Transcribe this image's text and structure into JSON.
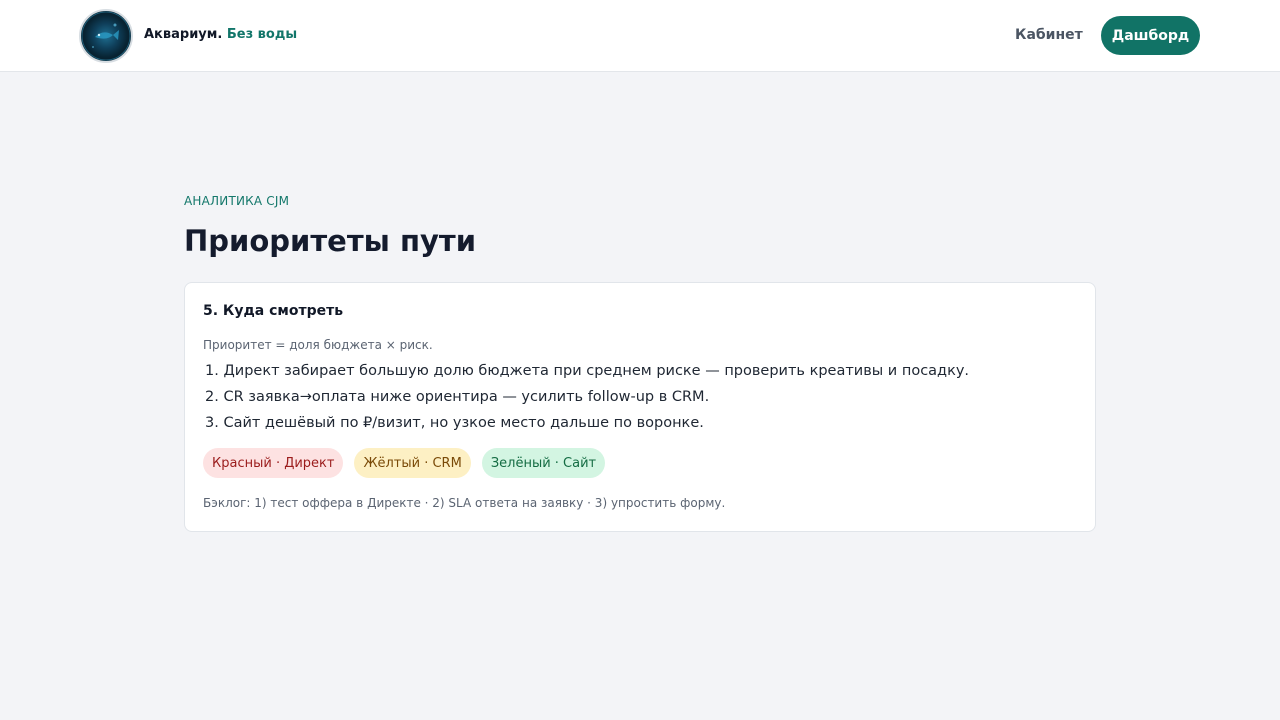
{
  "header": {
    "brand_name": "Аквариум.",
    "brand_tagline": "Без воды",
    "nav_link": "Кабинет",
    "cta_button": "Дашборд",
    "logo_icon": "aquarium-logo-icon"
  },
  "main": {
    "eyebrow": "АНАЛИТИКА CJM",
    "title": "Приоритеты пути",
    "card": {
      "title": "5. Куда смотреть",
      "note": "Приоритет = доля бюджета × риск.",
      "items": [
        "1. Директ забирает большую долю бюджета при среднем риске — проверить креативы и посадку.",
        "2. CR заявка→оплата ниже ориентира — усилить follow-up в CRM.",
        "3. Сайт дешёвый по ₽/визит, но узкое место дальше по воронке."
      ],
      "chips": [
        {
          "label": "Красный · Директ",
          "status": "red"
        },
        {
          "label": "Жёлтый · CRM",
          "status": "yellow"
        },
        {
          "label": "Зелёный · Сайт",
          "status": "green"
        }
      ],
      "backlog": "Бэклог: 1) тест оффера в Директе · 2) SLA ответа на заявку · 3) упростить форму."
    }
  },
  "colors": {
    "accent": "#117366",
    "background": "#f3f4f7",
    "chip_red_bg": "#fde2e2",
    "chip_yellow_bg": "#fdf0c4",
    "chip_green_bg": "#d3f5e2"
  }
}
